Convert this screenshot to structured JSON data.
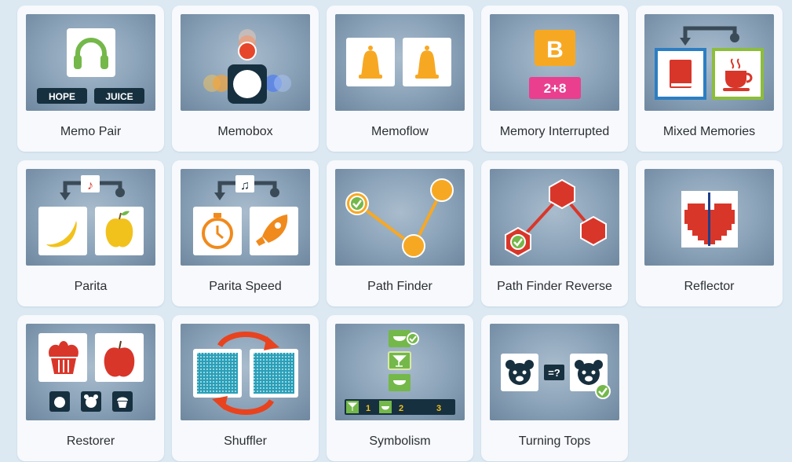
{
  "games": [
    {
      "id": "memo-pair",
      "label": "Memo Pair",
      "icon": "headphones-icon",
      "words": [
        "HOPE",
        "JUICE"
      ]
    },
    {
      "id": "memobox",
      "label": "Memobox",
      "icon": "light-ball-icon"
    },
    {
      "id": "memoflow",
      "label": "Memoflow",
      "icon": "bell-icon"
    },
    {
      "id": "memory-interrupted",
      "label": "Memory Interrupted",
      "icon": "letter-math-icon",
      "letter": "B",
      "sum": "2+8"
    },
    {
      "id": "mixed-memories",
      "label": "Mixed Memories",
      "icon": "book-cup-icon"
    },
    {
      "id": "parita",
      "label": "Parita",
      "icon": "fruit-swap-icon"
    },
    {
      "id": "parita-speed",
      "label": "Parita Speed",
      "icon": "timer-rocket-icon"
    },
    {
      "id": "path-finder",
      "label": "Path Finder",
      "icon": "path-dots-icon"
    },
    {
      "id": "path-finder-reverse",
      "label": "Path Finder Reverse",
      "icon": "hex-path-icon"
    },
    {
      "id": "reflector",
      "label": "Reflector",
      "icon": "pixel-heart-icon"
    },
    {
      "id": "restorer",
      "label": "Restorer",
      "icon": "cupcake-apple-icon"
    },
    {
      "id": "shuffler",
      "label": "Shuffler",
      "icon": "shuffle-cards-icon"
    },
    {
      "id": "symbolism",
      "label": "Symbolism",
      "icon": "symbol-stack-icon",
      "numbers": [
        "1",
        "2",
        "3"
      ]
    },
    {
      "id": "turning-tops",
      "label": "Turning Tops",
      "icon": "bear-compare-icon",
      "sign": "=?"
    }
  ],
  "colors": {
    "page_bg": "#dce9f3",
    "card_bg": "#f7f9fc",
    "accent_orange": "#f7a823",
    "accent_green": "#74b84a",
    "accent_red": "#d9362a",
    "accent_pink": "#ea3f8f",
    "dark_navy": "#17303f"
  }
}
